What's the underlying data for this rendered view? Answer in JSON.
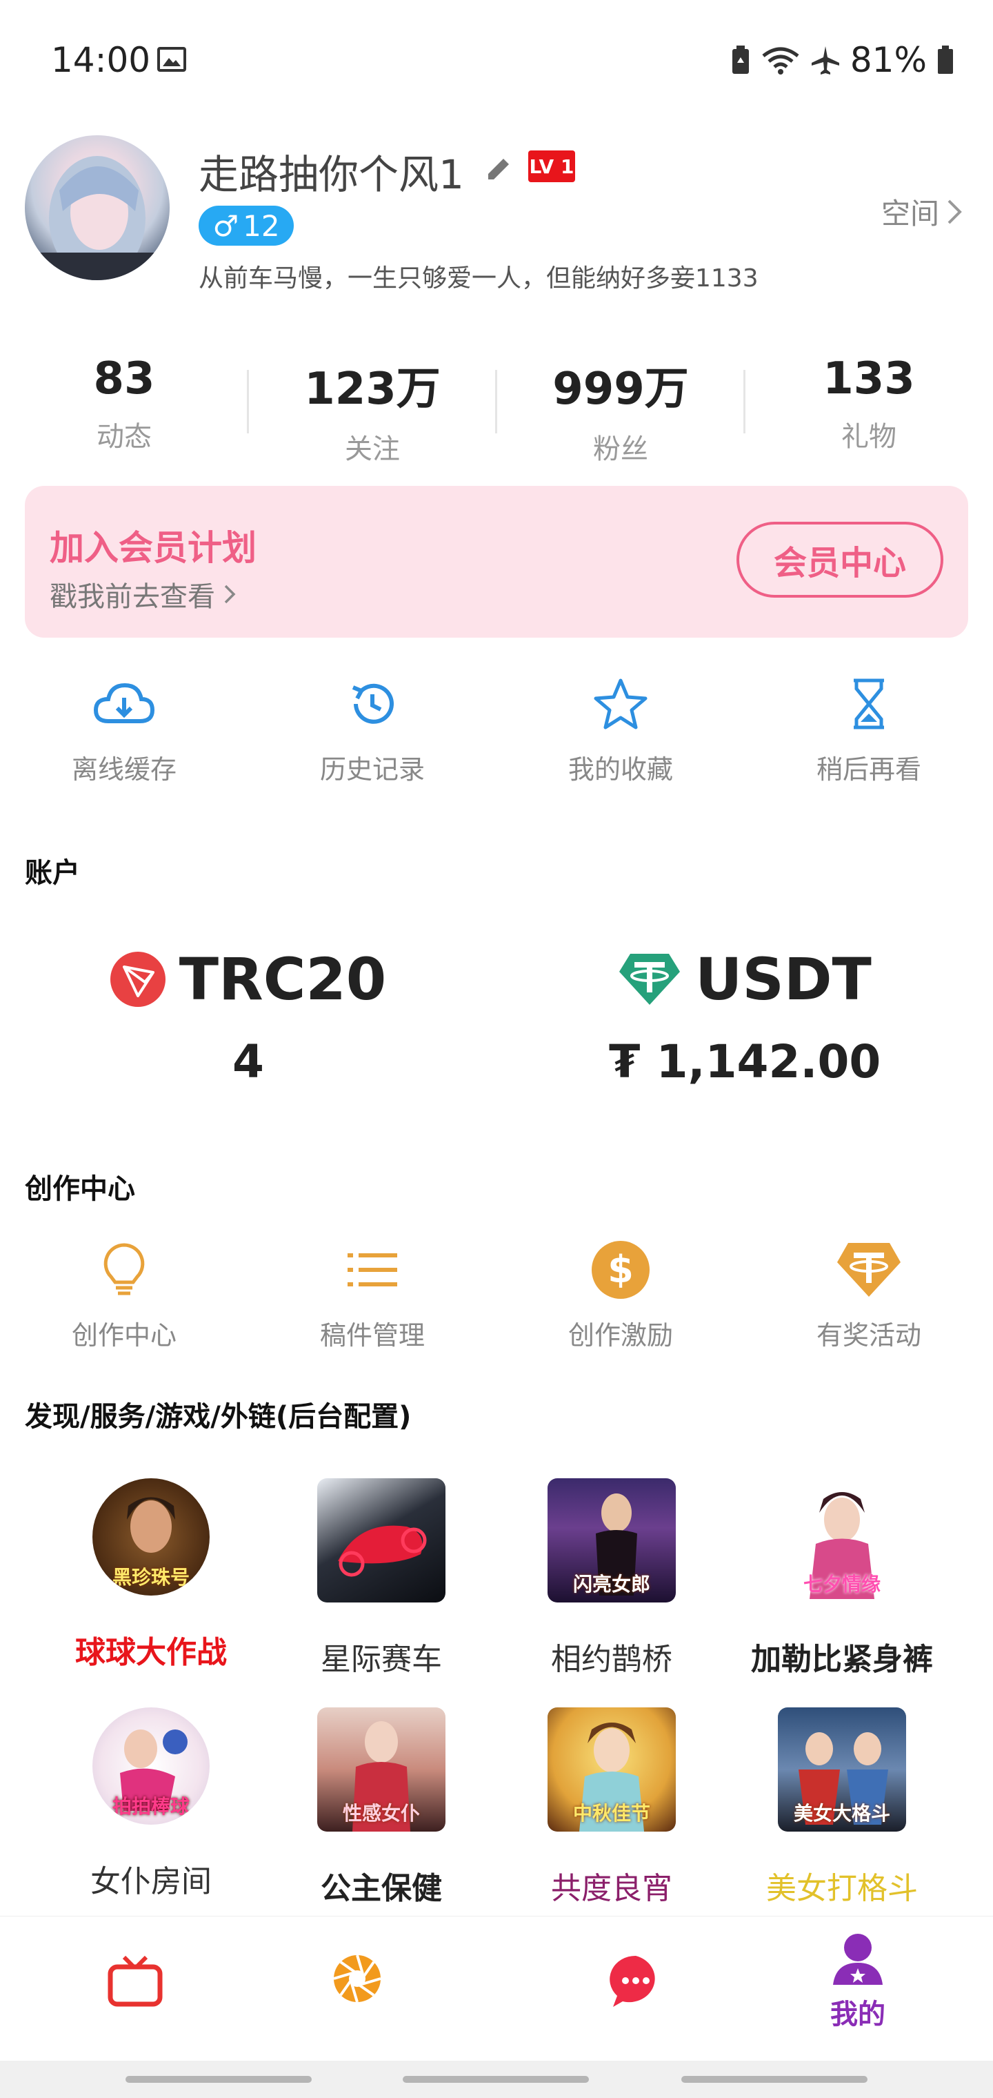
{
  "status_bar": {
    "time": "14:00",
    "battery": "81%"
  },
  "profile": {
    "username": "走路抽你个风1",
    "level": "LV 1",
    "gender_symbol": "♂",
    "age": "12",
    "bio": "从前车马慢，一生只够爱一人，但能纳好多妾1133",
    "space_link": "空间"
  },
  "stats": [
    {
      "value": "83",
      "label": "动态"
    },
    {
      "value": "123万",
      "label": "关注"
    },
    {
      "value": "999万",
      "label": "粉丝"
    },
    {
      "value": "133",
      "label": "礼物"
    }
  ],
  "membership": {
    "title": "加入会员计划",
    "subtitle": "戳我前去查看",
    "button": "会员中心",
    "accent": "#ef5f86"
  },
  "quick_actions": [
    {
      "label": "离线缓存",
      "icon": "cloud-download-icon"
    },
    {
      "label": "历史记录",
      "icon": "history-icon"
    },
    {
      "label": "我的收藏",
      "icon": "star-icon"
    },
    {
      "label": "稍后再看",
      "icon": "hourglass-icon"
    }
  ],
  "account": {
    "title": "账户",
    "items": [
      {
        "name": "TRC20",
        "value": "4",
        "icon": "tron-icon",
        "color": "#e84142"
      },
      {
        "name": "USDT",
        "value": "₮ 1,142.00",
        "icon": "tether-icon",
        "color": "#26a17b"
      }
    ]
  },
  "creation": {
    "title": "创作中心",
    "items": [
      {
        "label": "创作中心",
        "icon": "lightbulb-icon"
      },
      {
        "label": "稿件管理",
        "icon": "list-icon"
      },
      {
        "label": "创作激励",
        "icon": "dollar-icon"
      },
      {
        "label": "有奖活动",
        "icon": "tether-badge-icon"
      }
    ],
    "icon_color": "#e8a23a"
  },
  "discover": {
    "title": "发现/服务/游戏/外链(后台配置)",
    "games": [
      {
        "label": "球球大作战",
        "thumb_text": "黑珍珠号",
        "color": "#e8151b",
        "bold": true
      },
      {
        "label": "星际赛车",
        "thumb_text": "",
        "color": "#333333",
        "bold": false
      },
      {
        "label": "相约鹊桥",
        "thumb_text": "闪亮女郎",
        "color": "#333333",
        "bold": false
      },
      {
        "label": "加勒比紧身裤",
        "thumb_text": "七夕情缘",
        "color": "#222222",
        "bold": true
      },
      {
        "label": "女仆房间",
        "thumb_text": "拍拍棒球",
        "color": "#333333",
        "bold": false
      },
      {
        "label": "公主保健",
        "thumb_text": "性感女仆",
        "color": "#222222",
        "bold": true
      },
      {
        "label": "共度良宵",
        "thumb_text": "中秋佳节",
        "color": "#8b1f6a",
        "bold": false
      },
      {
        "label": "美女打格斗",
        "thumb_text": "美女大格斗",
        "color": "#e2c12a",
        "bold": false
      }
    ]
  },
  "bottom_nav": [
    {
      "icon": "tv-icon",
      "label": ""
    },
    {
      "icon": "camera-aperture-icon",
      "label": ""
    },
    {
      "icon": "chat-bubble-icon",
      "label": ""
    },
    {
      "icon": "profile-icon",
      "label": "我的",
      "active": true
    }
  ]
}
